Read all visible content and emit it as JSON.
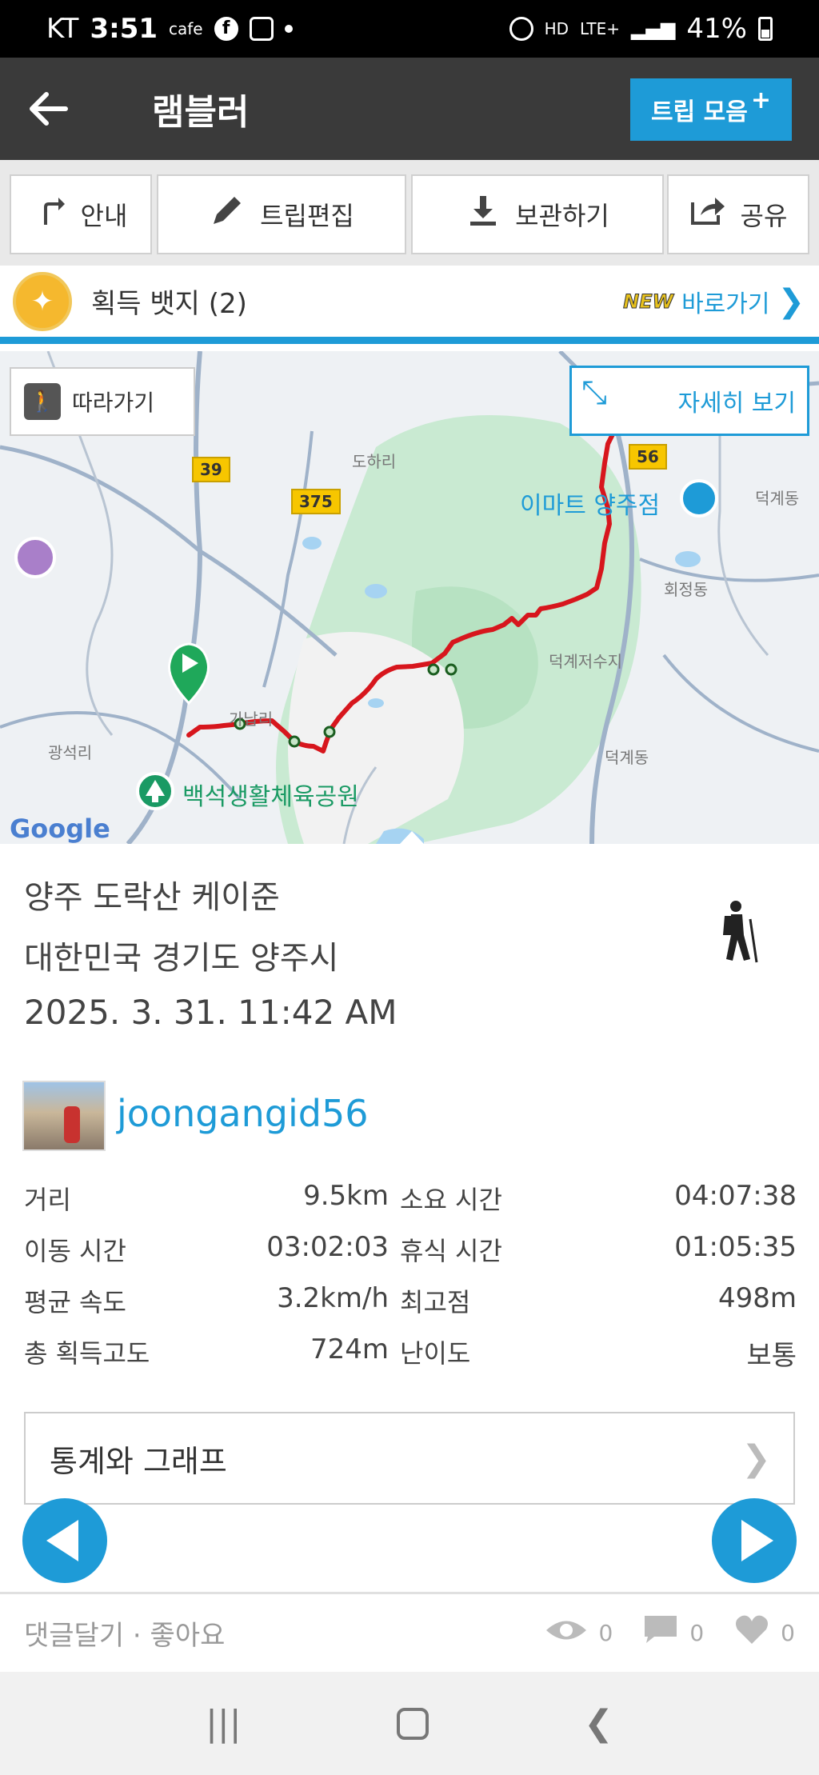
{
  "status_bar": {
    "carrier": "KT",
    "time": "3:51",
    "cafe": "cafe",
    "network": "LTE+",
    "battery": "41%"
  },
  "header": {
    "title": "램블러",
    "trip_collection_label": "트립 모음",
    "plus": "+"
  },
  "toolbar": {
    "guide_label": "안내",
    "edit_label": "트립편집",
    "save_label": "보관하기",
    "share_label": "공유"
  },
  "badge": {
    "label": "획득 뱃지 (2)",
    "new_tag": "NEW",
    "link_label": "바로가기"
  },
  "map": {
    "follow_label": "따라가기",
    "detail_label": "자세히 보기",
    "google": "Google",
    "road_39": "39",
    "road_375": "375",
    "road_56": "56",
    "emart": "이마트 양주점",
    "park": "백석생활체육공원",
    "places": [
      "도하리",
      "덕계동",
      "회정동",
      "덕계저수지",
      "가납리",
      "광석리",
      "덕계동"
    ]
  },
  "trip": {
    "title": "양주 도락산 케이준",
    "location": "대한민국 경기도 양주시",
    "date": "2025. 3. 31. 11:42 AM",
    "username": "joongangid56"
  },
  "stats": [
    {
      "label1": "거리",
      "value1": "9.5km",
      "label2": "소요 시간",
      "value2": "04:07:38"
    },
    {
      "label1": "이동 시간",
      "value1": "03:02:03",
      "label2": "휴식 시간",
      "value2": "01:05:35"
    },
    {
      "label1": "평균 속도",
      "value1": "3.2km/h",
      "label2": "최고점",
      "value2": "498m"
    },
    {
      "label1": "총 획득고도",
      "value1": "724m",
      "label2": "난이도",
      "value2": "보통"
    }
  ],
  "graph_button_label": "통계와 그래프",
  "comment_bar": {
    "label": "댓글달기 · 좋아요",
    "views": "0",
    "comments": "0",
    "likes": "0"
  },
  "colors": {
    "accent": "#1e9bd7",
    "header_bg": "#3a3a3a",
    "route": "#d7161d"
  }
}
